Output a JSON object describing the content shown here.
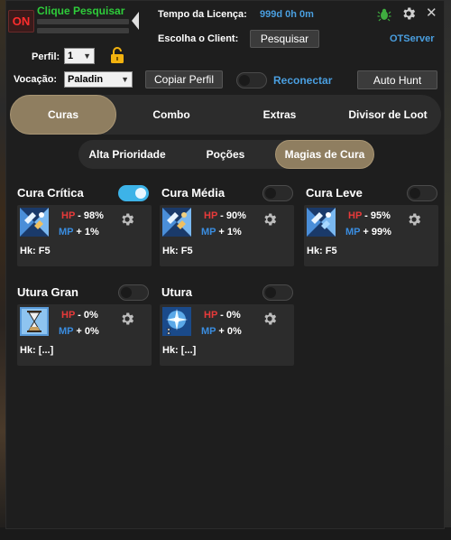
{
  "header": {
    "on_label": "ON",
    "clique_text": "Clique Pesquisar",
    "tempo_label": "Tempo da Licença:",
    "tempo_value": "999d 0h 0m",
    "escolha_label": "Escolha o Client:",
    "pesquisar_label": "Pesquisar",
    "server_name": "OTServer"
  },
  "profile": {
    "perfil_label": "Perfil:",
    "perfil_value": "1",
    "vocacao_label": "Vocação:",
    "vocacao_value": "Paladin",
    "copiar_label": "Copiar Perfil",
    "reconectar_label": "Reconectar",
    "autohunt_label": "Auto Hunt"
  },
  "main_tabs": [
    "Curas",
    "Combo",
    "Extras",
    "Divisor de Loot"
  ],
  "sub_tabs": [
    "Alta Prioridade",
    "Poções",
    "Magias de Cura"
  ],
  "spells": [
    {
      "name": "Cura Crítica",
      "enabled": true,
      "hp_sign": "-",
      "hp_value": "98%",
      "mp_sign": "+",
      "mp_value": "1%",
      "hk": "Hk: F5"
    },
    {
      "name": "Cura Média",
      "enabled": false,
      "hp_sign": "-",
      "hp_value": "90%",
      "mp_sign": "+",
      "mp_value": "1%",
      "hk": "Hk: F5"
    },
    {
      "name": "Cura Leve",
      "enabled": false,
      "hp_sign": "-",
      "hp_value": "95%",
      "mp_sign": "+",
      "mp_value": "99%",
      "hk": "Hk: F5"
    },
    {
      "name": "Utura Gran",
      "enabled": false,
      "hp_sign": "-",
      "hp_value": "0%",
      "mp_sign": "+",
      "mp_value": "0%",
      "hk": "Hk: [...]"
    },
    {
      "name": "Utura",
      "enabled": false,
      "hp_sign": "-",
      "hp_value": "0%",
      "mp_sign": "+",
      "mp_value": "0%",
      "hk": "Hk: [...]"
    }
  ],
  "labels": {
    "hp": "HP",
    "mp": "MP"
  },
  "colors": {
    "accent": "#8f7e60",
    "link": "#4a9fe0",
    "hp": "#e83a3a",
    "mp": "#3a8de0",
    "on": "#ff2d2d",
    "toggle_on": "#3db3e8"
  },
  "icons": {
    "bug": "bug-icon",
    "gear": "gear-icon",
    "close": "close-icon",
    "lock": "lock-icon"
  }
}
